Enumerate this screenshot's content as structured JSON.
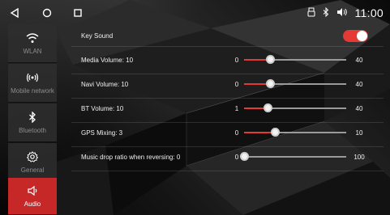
{
  "status": {
    "time": "11:00"
  },
  "sidebar": {
    "items": [
      {
        "label": "WLAN",
        "icon": "wifi-icon",
        "active": false
      },
      {
        "label": "Mobile network",
        "icon": "signal-icon",
        "active": false
      },
      {
        "label": "Bluetooth",
        "icon": "bluetooth-icon",
        "active": false
      },
      {
        "label": "General",
        "icon": "gear-icon",
        "active": false
      },
      {
        "label": "Audio",
        "icon": "speaker-icon",
        "active": true
      }
    ]
  },
  "settings": {
    "key_sound": {
      "label": "Key Sound",
      "enabled": true
    },
    "sliders": [
      {
        "label": "Media Volume: 10",
        "min": "0",
        "max": "40",
        "value": 10,
        "range": [
          0,
          40
        ]
      },
      {
        "label": "Navi Volume: 10",
        "min": "0",
        "max": "40",
        "value": 10,
        "range": [
          0,
          40
        ]
      },
      {
        "label": "BT Volume: 10",
        "min": "1",
        "max": "40",
        "value": 10,
        "range": [
          1,
          40
        ]
      },
      {
        "label": "GPS Mixing: 3",
        "min": "0",
        "max": "10",
        "value": 3,
        "range": [
          0,
          10
        ]
      },
      {
        "label": "Music drop ratio when reversing: 0",
        "min": "0",
        "max": "100",
        "value": 0,
        "range": [
          0,
          100
        ]
      }
    ]
  },
  "colors": {
    "accent": "#e53935",
    "active_tab": "#c62828",
    "sidebar_bg": "#2d2d2d"
  }
}
